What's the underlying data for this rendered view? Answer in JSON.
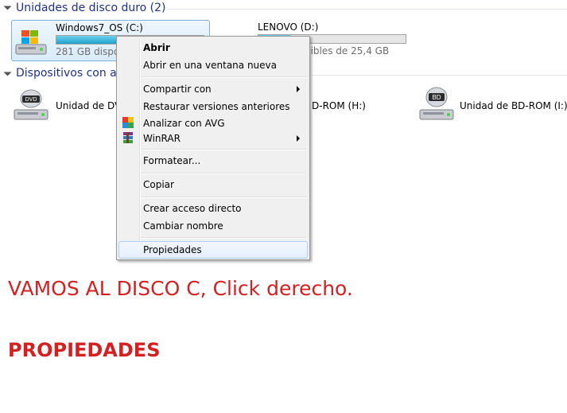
{
  "groups": {
    "hdd_title": "Unidades de disco duro (2)",
    "devices_title": "Dispositivos con al"
  },
  "drives": [
    {
      "name": "Windows7_OS (C:)",
      "free_text": "281 GB dispon",
      "used_fraction": 0.45
    },
    {
      "name": "LENOVO (D:)",
      "free_text": "ponibles de 25,4 GB",
      "used_fraction": 0.22
    }
  ],
  "devices": [
    {
      "label": "Unidad de DVD",
      "icon_text": "DVD",
      "icon": "dvd-drive-icon"
    },
    {
      "label": "D-ROM (H:)",
      "icon": "disc-drive-icon"
    },
    {
      "label": "Unidad de BD-ROM (I:)",
      "icon_text": "BD",
      "icon": "bd-drive-icon"
    }
  ],
  "context_menu": {
    "items": [
      {
        "label": "Abrir",
        "bold": true
      },
      {
        "label": "Abrir en una ventana nueva"
      },
      {
        "label": "Compartir con",
        "submenu": true
      },
      {
        "label": "Restaurar versiones anteriores"
      },
      {
        "label": "Analizar con AVG",
        "icon": "avg-icon"
      },
      {
        "label": "WinRAR",
        "icon": "winrar-icon",
        "submenu": true
      },
      {
        "label": "Formatear..."
      },
      {
        "label": "Copiar"
      },
      {
        "label": "Crear acceso directo"
      },
      {
        "label": "Cambiar nombre"
      },
      {
        "label": "Propiedades",
        "highlighted": true
      }
    ]
  },
  "annotation": {
    "line1": "VAMOS AL DISCO C, Click derecho.",
    "line2": "PROPIEDADES"
  },
  "colors": {
    "header_text": "#1e3287",
    "annotation": "#d42020",
    "selection": "#d9ecfb"
  }
}
